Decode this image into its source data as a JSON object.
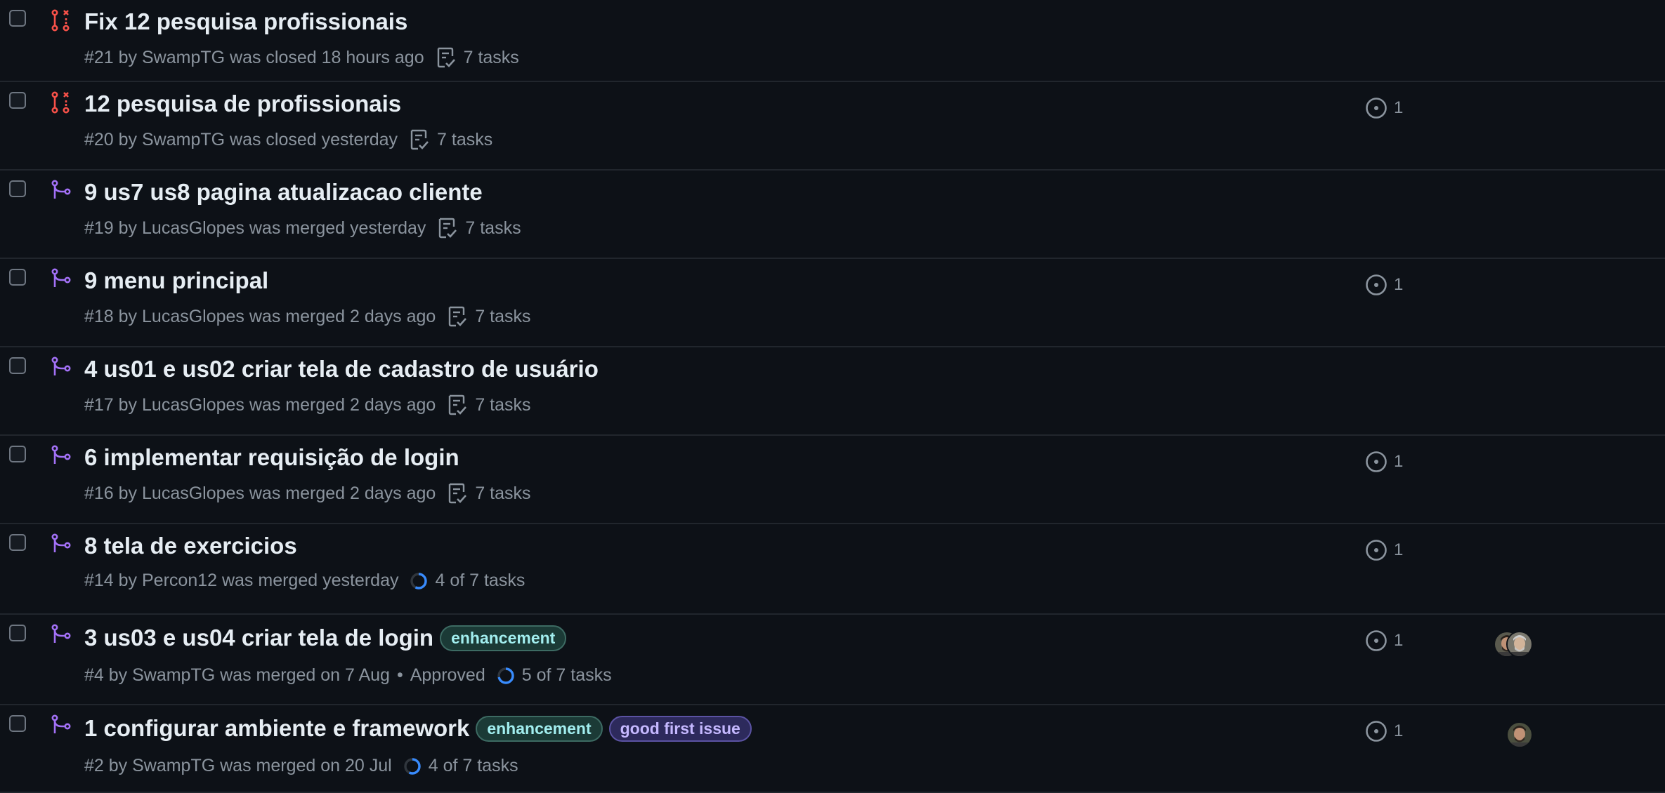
{
  "colors": {
    "background": "#0d1117",
    "closed": "#f85149",
    "merged": "#a371f7",
    "muted": "#8b949e",
    "progress": "#388bfd",
    "label_enhancement_bg": "#1b3a36",
    "label_enhancement_fg": "#a2eeef",
    "label_good_first_bg": "#2d2a5c",
    "label_good_first_fg": "#c5b8ff"
  },
  "pull_requests": [
    {
      "title": "Fix 12 pesquisa profissionais",
      "meta": "#21 by SwampTG was closed 18 hours ago",
      "tasks": "7 tasks",
      "task_icon": "checklist-icon",
      "state": "closed",
      "comments": "",
      "labels": [],
      "approved": "",
      "avatars": 0
    },
    {
      "title": "12 pesquisa de profissionais",
      "meta": "#20 by SwampTG was closed yesterday",
      "tasks": "7 tasks",
      "task_icon": "checklist-icon",
      "state": "closed",
      "comments": "1",
      "labels": [],
      "approved": "",
      "avatars": 0
    },
    {
      "title": "9 us7 us8 pagina atualizacao cliente",
      "meta": "#19 by LucasGlopes was merged yesterday",
      "tasks": "7 tasks",
      "task_icon": "checklist-icon",
      "state": "merged",
      "comments": "",
      "labels": [],
      "approved": "",
      "avatars": 0
    },
    {
      "title": "9 menu principal",
      "meta": "#18 by LucasGlopes was merged 2 days ago",
      "tasks": "7 tasks",
      "task_icon": "checklist-icon",
      "state": "merged",
      "comments": "1",
      "labels": [],
      "approved": "",
      "avatars": 0
    },
    {
      "title": "4 us01 e us02 criar tela de cadastro de usuário",
      "meta": "#17 by LucasGlopes was merged 2 days ago",
      "tasks": "7 tasks",
      "task_icon": "checklist-icon",
      "state": "merged",
      "comments": "",
      "labels": [],
      "approved": "",
      "avatars": 0
    },
    {
      "title": "6 implementar requisição de login",
      "meta": "#16 by LucasGlopes was merged 2 days ago",
      "tasks": "7 tasks",
      "task_icon": "checklist-icon",
      "state": "merged",
      "comments": "1",
      "labels": [],
      "approved": "",
      "avatars": 0
    },
    {
      "title": "8 tela de exercicios",
      "meta": "#14 by Percon12 was merged yesterday",
      "tasks": "4 of 7 tasks",
      "task_icon": "progress-ring-icon",
      "progress": 0.571,
      "state": "merged",
      "comments": "1",
      "labels": [],
      "approved": "",
      "avatars": 0
    },
    {
      "title": "3 us03 e us04 criar tela de login",
      "meta": "#4 by SwampTG was merged on 7 Aug",
      "tasks": "5 of 7 tasks",
      "task_icon": "progress-ring-icon",
      "progress": 0.714,
      "state": "merged",
      "comments": "1",
      "labels": [
        {
          "text": "enhancement",
          "kind": "enhancement"
        }
      ],
      "approved": "Approved",
      "avatars": 2
    },
    {
      "title": "1 configurar ambiente e framework",
      "meta": "#2 by SwampTG was merged on 20 Jul",
      "tasks": "4 of 7 tasks",
      "task_icon": "progress-ring-icon",
      "progress": 0.571,
      "state": "merged",
      "comments": "1",
      "labels": [
        {
          "text": "enhancement",
          "kind": "enhancement"
        },
        {
          "text": "good first issue",
          "kind": "good-first"
        }
      ],
      "approved": "",
      "avatars": 1
    }
  ]
}
